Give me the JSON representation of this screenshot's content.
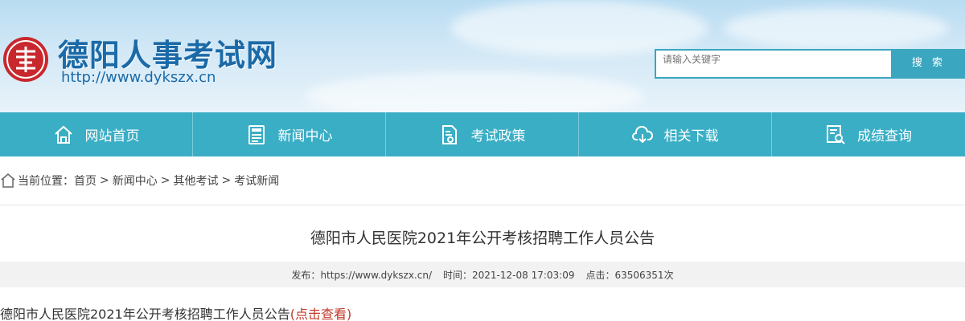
{
  "site": {
    "name": "德阳人事考试网",
    "url": "http://www.dykszx.cn",
    "logo_glyph": "弎"
  },
  "search": {
    "placeholder": "请输入关键字",
    "button_label": "搜 索"
  },
  "nav": {
    "items": [
      {
        "label": "网站首页",
        "icon": "home-icon"
      },
      {
        "label": "新闻中心",
        "icon": "news-icon"
      },
      {
        "label": "考试政策",
        "icon": "policy-icon"
      },
      {
        "label": "相关下载",
        "icon": "cloud-download-icon"
      },
      {
        "label": "成绩查询",
        "icon": "score-search-icon"
      }
    ]
  },
  "breadcrumb": {
    "prefix": "当前位置：",
    "items": [
      "首页",
      "新闻中心",
      "其他考试",
      "考试新闻"
    ],
    "sep": ">"
  },
  "article": {
    "title": "德阳市人民医院2021年公开考核招聘工作人员公告",
    "meta": {
      "publisher_label": "发布：",
      "publisher": "https://www.dykszx.cn/",
      "time_label": "时间：",
      "time": "2021-12-08 17:03:09",
      "clicks_label": "点击：",
      "clicks": "63506351次"
    },
    "body_text": "德阳市人民医院2021年公开考核招聘工作人员公告",
    "body_link": "(点击查看)"
  },
  "colors": {
    "brand_blue": "#1b6aa8",
    "nav_teal": "#3aaec5",
    "seal_red": "#c8282d",
    "link_red": "#c0392b"
  }
}
